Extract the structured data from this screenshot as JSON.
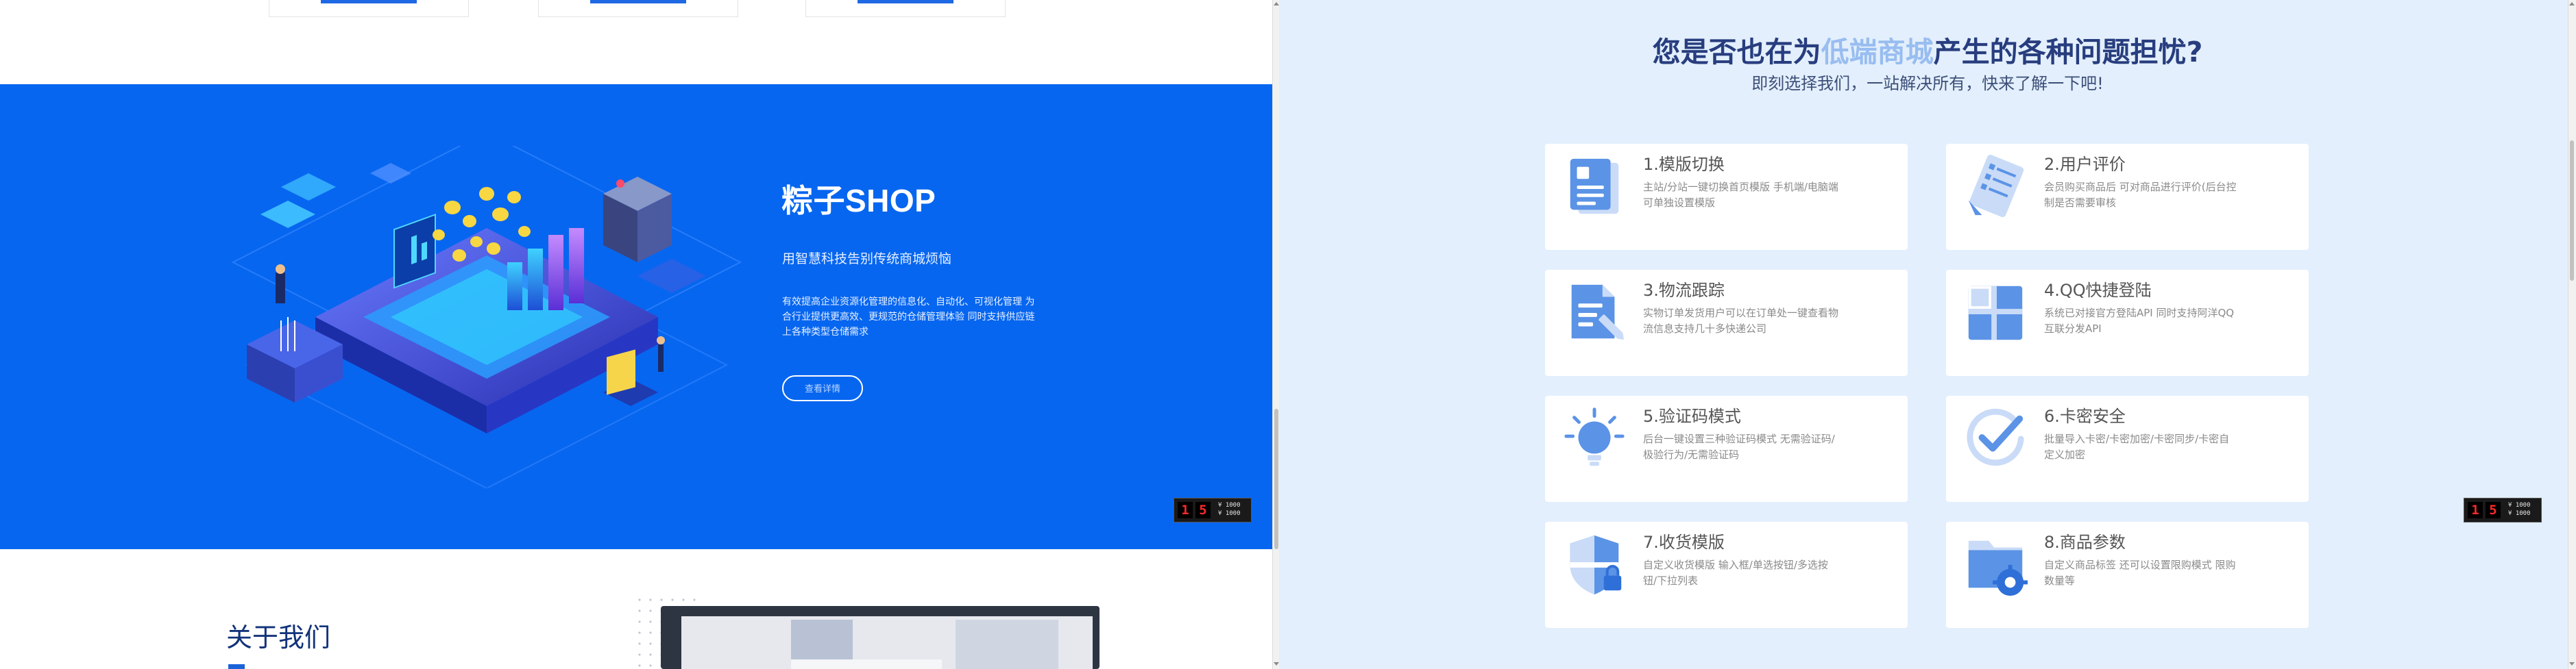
{
  "left": {
    "banner": {
      "title": "粽子SHOP",
      "subtitle": "用智慧科技告别传统商城烦恼",
      "description": "有效提高企业资源化管理的信息化、自动化、可视化管理 为合行业提供更高效、更规范的仓储管理体验 同时支持供应链上各种类型仓储需求",
      "button_label": "查看详情",
      "colors": {
        "background": "#0766f0"
      }
    },
    "badge": {
      "digits": [
        "1",
        "5"
      ],
      "line1": "¥ 1000",
      "line2": "¥ 1000"
    },
    "about": {
      "title": "关于我们"
    }
  },
  "right": {
    "headline": {
      "prefix": "您是否也在为",
      "highlight": "低端商城",
      "suffix": "产生的各种问题担忧?"
    },
    "subline": "即刻选择我们，一站解决所有，快来了解一下吧!",
    "features": [
      {
        "title": "1.模版切换",
        "desc": "主站/分站一键切换首页模版 手机端/电脑端可单独设置模版",
        "icon": "template-icon"
      },
      {
        "title": "2.用户评价",
        "desc": "会员购买商品后 可对商品进行评价(后台控制是否需要审核",
        "icon": "review-icon"
      },
      {
        "title": "3.物流跟踪",
        "desc": "实物订单发货用户可以在订单处一键查看物流信息支持几十多快递公司",
        "icon": "logistics-icon"
      },
      {
        "title": "4.QQ快捷登陆",
        "desc": "系统已对接官方登陆API 同时支持阿洋QQ互联分发API",
        "icon": "qq-login-icon"
      },
      {
        "title": "5.验证码模式",
        "desc": "后台一键设置三种验证码模式 无需验证码/极验行为/无需验证码",
        "icon": "captcha-icon"
      },
      {
        "title": "6.卡密安全",
        "desc": "批量导入卡密/卡密加密/卡密同步/卡密自定义加密",
        "icon": "card-security-icon"
      },
      {
        "title": "7.收货模版",
        "desc": "自定义收货模版 输入框/单选按钮/多选按钮/下拉列表",
        "icon": "shipping-template-icon"
      },
      {
        "title": "8.商品参数",
        "desc": "自定义商品标签 还可以设置限购模式 限购数量等",
        "icon": "product-params-icon"
      }
    ],
    "badge": {
      "digits": [
        "1",
        "5"
      ],
      "line1": "¥ 1000",
      "line2": "¥ 1000"
    },
    "colors": {
      "background": "#e3effc",
      "highlight": "#98bdf0",
      "title": "#273d7e"
    }
  }
}
